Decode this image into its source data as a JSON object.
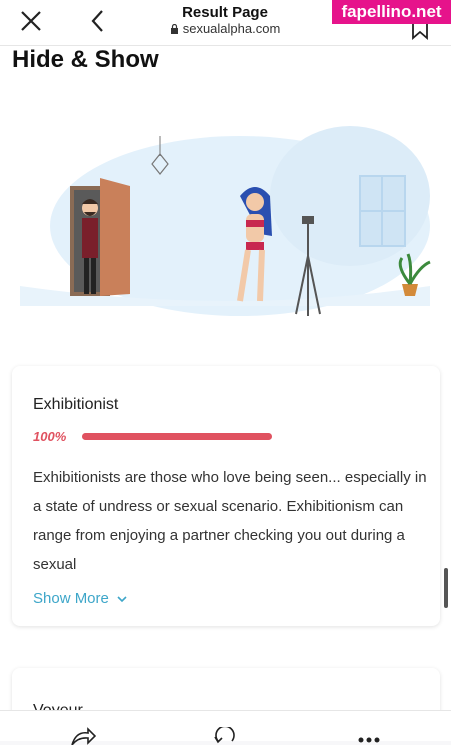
{
  "browser": {
    "title": "Result Page",
    "url": "sexualalpha.com",
    "watermark": "fapellino.net"
  },
  "section": {
    "heading": "Hide & Show"
  },
  "results": [
    {
      "name": "Exhibitionist",
      "percent_label": "100%",
      "percent_value": 100,
      "description": "Exhibitionists are those who love being seen... especially in a state of undress or sexual scenario. Exhibitionism can range from enjoying a partner checking you out during a sexual",
      "show_more": "Show More"
    },
    {
      "name": "Voyeur"
    }
  ],
  "colors": {
    "accent_red": "#e05260",
    "link_blue": "#3da6c9",
    "watermark_pink": "#e6138b"
  }
}
